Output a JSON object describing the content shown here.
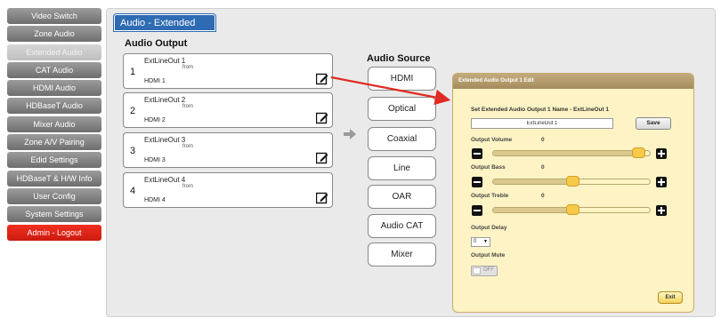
{
  "sidebar": {
    "items": [
      {
        "label": "Video Switch"
      },
      {
        "label": "Zone Audio"
      },
      {
        "label": "Extended Audio"
      },
      {
        "label": "CAT Audio"
      },
      {
        "label": "HDMI Audio"
      },
      {
        "label": "HDBaseT Audio"
      },
      {
        "label": "Mixer Audio"
      },
      {
        "label": "Zone A/V Pairing"
      },
      {
        "label": "Edid Settings"
      },
      {
        "label": "HDBaseT & H/W Info"
      },
      {
        "label": "User Config"
      },
      {
        "label": "System Settings"
      },
      {
        "label": "Admin - Logout"
      }
    ],
    "active_index": 2
  },
  "page": {
    "title": "Audio - Extended",
    "output_heading": "Audio Output",
    "source_heading": "Audio Source"
  },
  "outputs": [
    {
      "num": "1",
      "name": "ExtLineOut 1",
      "from": "from",
      "source": "HDMI 1"
    },
    {
      "num": "2",
      "name": "ExtLineOut 2",
      "from": "from",
      "source": "HDMI 2"
    },
    {
      "num": "3",
      "name": "ExtLineOut 3",
      "from": "from",
      "source": "HDMI 3"
    },
    {
      "num": "4",
      "name": "ExtLineOut 4",
      "from": "from",
      "source": "HDMI 4"
    }
  ],
  "sources": [
    "HDMI",
    "Optical",
    "Coaxial",
    "Line",
    "OAR",
    "Audio CAT",
    "Mixer"
  ],
  "dialog": {
    "title": "Extended Audio Output 1 Edit",
    "name_label": "Set Extended Audio Output 1 Name - ExtLineOut 1",
    "name_value": "ExtLineOut 1",
    "save_label": "Save",
    "volume_label": "Output Volume",
    "volume_value": "0",
    "volume_level": 0.96,
    "bass_label": "Output Bass",
    "bass_value": "0",
    "bass_level": 0.5,
    "treble_label": "Output Treble",
    "treble_value": "0",
    "treble_level": 0.5,
    "delay_label": "Output Delay",
    "delay_value": "0",
    "mute_label": "Output Mute",
    "mute_state": "OFF",
    "exit_label": "Exit"
  },
  "colors": {
    "title_tab": "#2e6bb2",
    "logout": "#e2261a",
    "dialog_bg": "#fef3c4",
    "dialog_header": "#b39b6d",
    "slider_thumb": "#f7c948",
    "pointer_arrow": "#e02a22"
  }
}
